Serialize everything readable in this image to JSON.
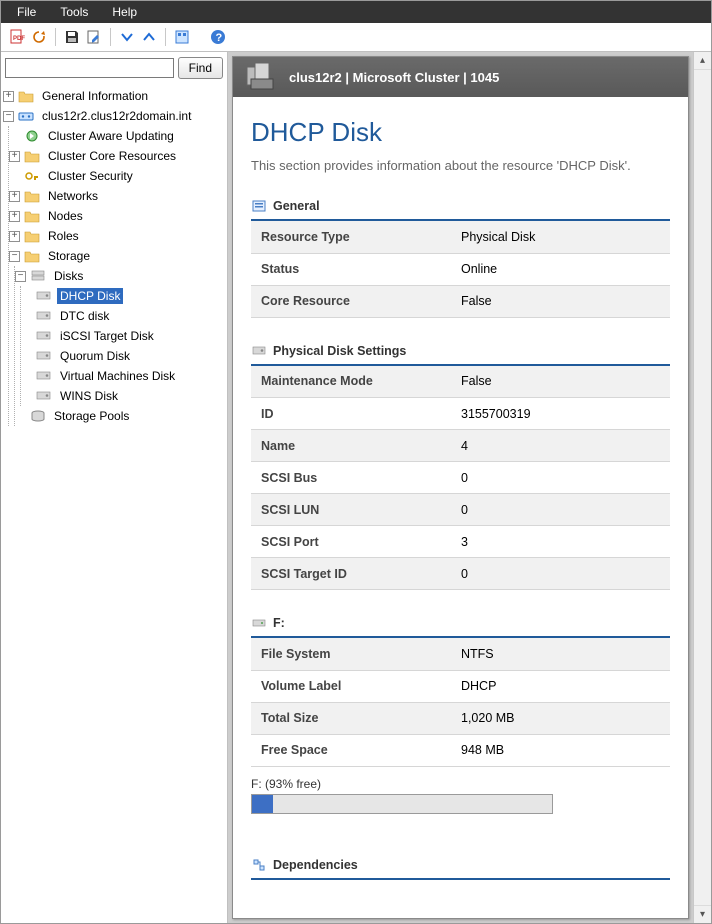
{
  "menu": {
    "file": "File",
    "tools": "Tools",
    "help": "Help"
  },
  "search": {
    "placeholder": "",
    "find_label": "Find"
  },
  "tree": {
    "general_information": "General Information",
    "cluster_root": "clus12r2.clus12r2domain.int",
    "cluster_aware_updating": "Cluster Aware Updating",
    "cluster_core_resources": "Cluster Core Resources",
    "cluster_security": "Cluster Security",
    "networks": "Networks",
    "nodes": "Nodes",
    "roles": "Roles",
    "storage": "Storage",
    "disks": "Disks",
    "dhcp_disk": "DHCP Disk",
    "dtc_disk": "DTC disk",
    "iscsi_target_disk": "iSCSI Target Disk",
    "quorum_disk": "Quorum Disk",
    "virtual_machines_disk": "Virtual Machines Disk",
    "wins_disk": "WINS Disk",
    "storage_pools": "Storage Pools"
  },
  "header": {
    "title": "clus12r2 | Microsoft Cluster | 1045"
  },
  "page": {
    "title": "DHCP Disk",
    "subtitle": "This section provides information about the resource 'DHCP Disk'."
  },
  "sections": {
    "general": "General",
    "physical": "Physical Disk Settings",
    "drive": "F:",
    "dependencies": "Dependencies"
  },
  "general": {
    "resource_type_k": "Resource Type",
    "resource_type_v": "Physical Disk",
    "status_k": "Status",
    "status_v": "Online",
    "core_resource_k": "Core Resource",
    "core_resource_v": "False"
  },
  "physical": {
    "maintenance_mode_k": "Maintenance Mode",
    "maintenance_mode_v": "False",
    "id_k": "ID",
    "id_v": "3155700319",
    "name_k": "Name",
    "name_v": "4",
    "scsi_bus_k": "SCSI Bus",
    "scsi_bus_v": "0",
    "scsi_lun_k": "SCSI LUN",
    "scsi_lun_v": "0",
    "scsi_port_k": "SCSI Port",
    "scsi_port_v": "3",
    "scsi_target_k": "SCSI Target ID",
    "scsi_target_v": "0"
  },
  "drive": {
    "fs_k": "File System",
    "fs_v": "NTFS",
    "label_k": "Volume Label",
    "label_v": "DHCP",
    "total_k": "Total Size",
    "total_v": "1,020 MB",
    "free_k": "Free Space",
    "free_v": "948 MB",
    "freebar_label": "F: (93% free)",
    "freebar_used_pct": "7"
  }
}
